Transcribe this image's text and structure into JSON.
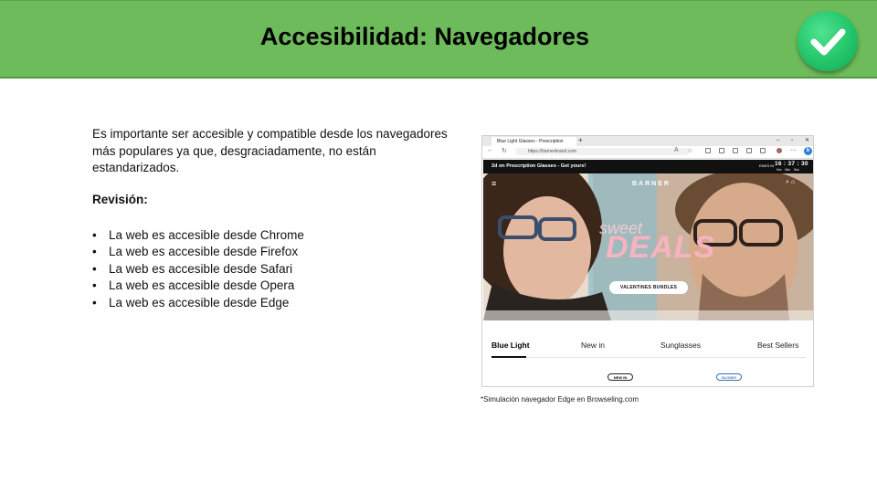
{
  "slide": {
    "title": "Accesibilidad: Navegadores",
    "intro_lines": [
      "Es importante ser accesible y compatible desde los navegadores",
      "más populares ya que, desgraciadamente, no están",
      "estandarizados."
    ],
    "revision_label": "Revisión:",
    "checklist": [
      "La web es accesible desde Chrome",
      "La web es accesible desde Firefox",
      "La web es accesible desde Safari",
      "La web es accesible desde Opera",
      "La web es accesible desde Edge"
    ],
    "caption": "*Simulación navegador Edge en Browseling.com",
    "check_icon": "checkmark-icon",
    "colors": {
      "header": "#6dbb5a",
      "check": "#23c56a"
    }
  },
  "browser": {
    "tab_title": "Blue Light Glasses - Prescription",
    "url": "https://barnerbrand.com",
    "promo_text": "2d on Prescription Glasses - Get yours!",
    "ends_in_label": "ENDS IN",
    "timer": "16 : 37 : 30",
    "timer_units": "Hrs Min Sec",
    "brand": "BARNER",
    "hero_script": "sweet",
    "hero_headline": "DEALS",
    "hero_button": "VALENTINES BUNDLES",
    "categories": [
      "Blue Light",
      "New in",
      "Sunglasses",
      "Best Sellers"
    ],
    "active_category": "Blue Light",
    "pills": [
      "NEW IN",
      "GLOSSY"
    ]
  }
}
